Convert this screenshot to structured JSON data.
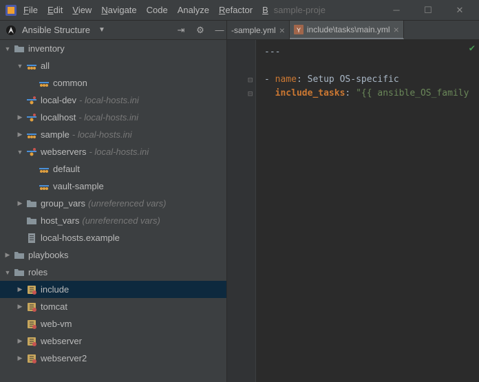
{
  "menu": {
    "items": [
      "File",
      "Edit",
      "View",
      "Navigate",
      "Code",
      "Analyze",
      "Refactor",
      "B"
    ]
  },
  "project_name": "sample-proje",
  "tool_window": {
    "title": "Ansible Structure"
  },
  "tabs": [
    {
      "label": "-sample.yml",
      "active": false
    },
    {
      "label": "include\\tasks\\main.yml",
      "active": true
    }
  ],
  "tree": [
    {
      "depth": 0,
      "tw": "open",
      "icon": "folder",
      "label": "inventory"
    },
    {
      "depth": 1,
      "tw": "open",
      "icon": "group",
      "label": "all"
    },
    {
      "depth": 2,
      "tw": "none",
      "icon": "group",
      "label": "common"
    },
    {
      "depth": 1,
      "tw": "none",
      "icon": "host",
      "label": "local-dev",
      "hint": "local-hosts.ini"
    },
    {
      "depth": 1,
      "tw": "closed",
      "icon": "host",
      "label": "localhost",
      "hint": "local-hosts.ini"
    },
    {
      "depth": 1,
      "tw": "closed",
      "icon": "group",
      "label": "sample",
      "hint": "local-hosts.ini"
    },
    {
      "depth": 1,
      "tw": "open",
      "icon": "host",
      "label": "webservers",
      "hint": "local-hosts.ini"
    },
    {
      "depth": 2,
      "tw": "none",
      "icon": "group",
      "label": "default"
    },
    {
      "depth": 2,
      "tw": "none",
      "icon": "group",
      "label": "vault-sample"
    },
    {
      "depth": 1,
      "tw": "closed",
      "icon": "folder",
      "label": "group_vars",
      "hint": "(unreferenced vars)"
    },
    {
      "depth": 1,
      "tw": "none",
      "icon": "folder",
      "label": "host_vars",
      "hint": "(unreferenced vars)"
    },
    {
      "depth": 1,
      "tw": "none",
      "icon": "file",
      "label": "local-hosts.example"
    },
    {
      "depth": 0,
      "tw": "closed",
      "icon": "folder",
      "label": "playbooks"
    },
    {
      "depth": 0,
      "tw": "open",
      "icon": "folder",
      "label": "roles"
    },
    {
      "depth": 1,
      "tw": "closed",
      "icon": "role",
      "label": "include",
      "selected": true
    },
    {
      "depth": 1,
      "tw": "closed",
      "icon": "role",
      "label": "tomcat"
    },
    {
      "depth": 1,
      "tw": "none",
      "icon": "role",
      "label": "web-vm"
    },
    {
      "depth": 1,
      "tw": "closed",
      "icon": "role",
      "label": "webserver"
    },
    {
      "depth": 1,
      "tw": "closed",
      "icon": "role",
      "label": "webserver2"
    }
  ],
  "editor": {
    "l1": "---",
    "l3_dash": "- ",
    "l3_key": "name",
    "l3_colon": ": ",
    "l3_val": "Setup OS-specific",
    "l4_key": "include_tasks",
    "l4_colon": ": ",
    "l4_val": "\"{{ ansible_OS_family "
  }
}
